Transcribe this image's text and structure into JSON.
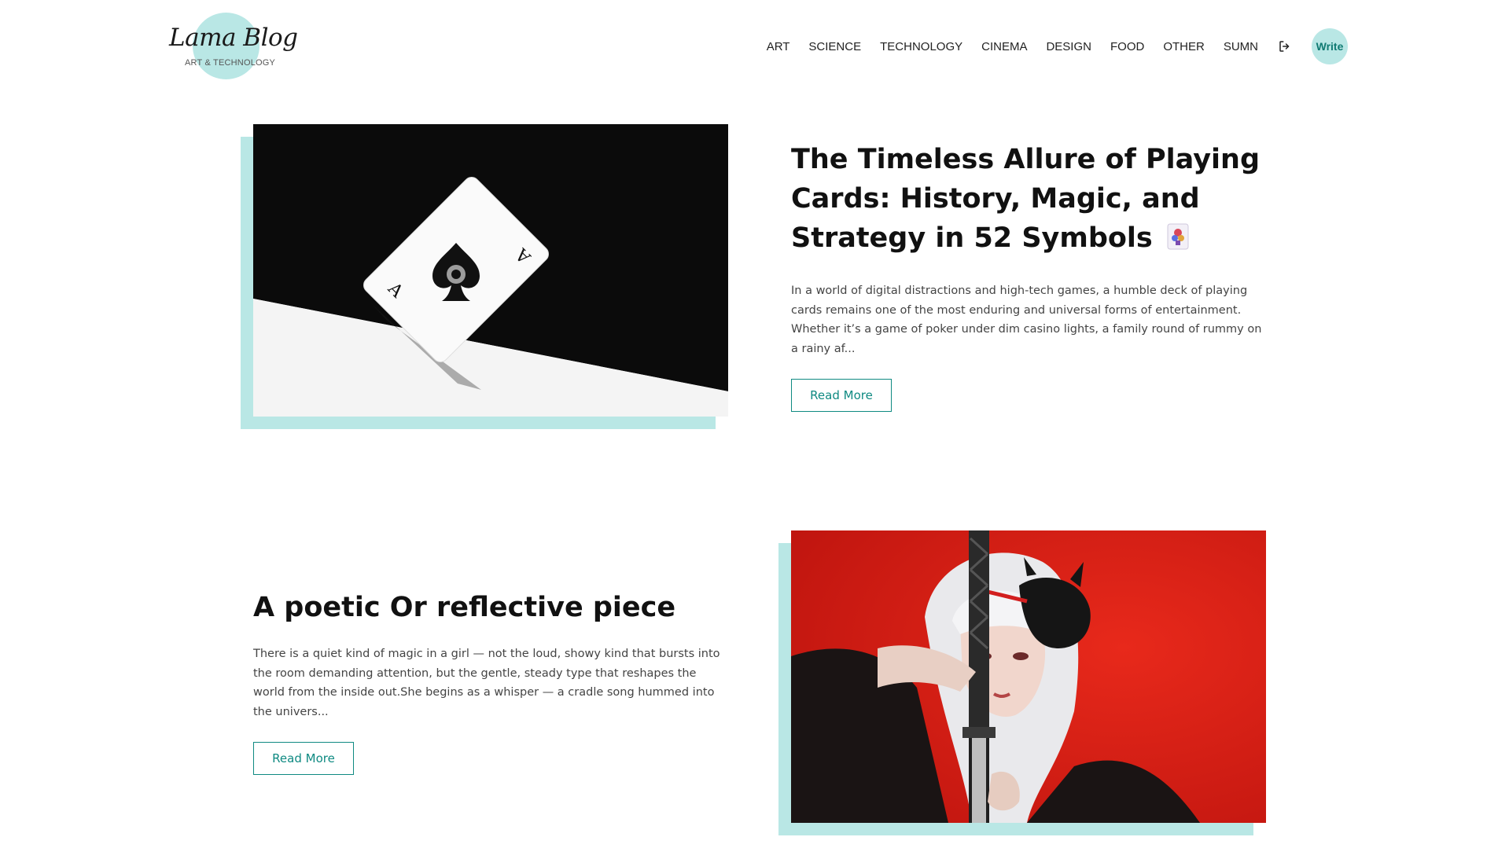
{
  "logo": {
    "title": "Lama Blog",
    "subtitle": "ART & TECHNOLOGY"
  },
  "nav": {
    "links": [
      "ART",
      "SCIENCE",
      "TECHNOLOGY",
      "CINEMA",
      "DESIGN",
      "FOOD",
      "OTHER",
      "SUMN"
    ],
    "write_label": "Write",
    "logout_icon": "logout-icon"
  },
  "posts": [
    {
      "title": "The Timeless Allure of Playing Cards: History, Magic, and Strategy in 52 Symbols",
      "title_emoji": "playing-card-icon",
      "desc": "In a world of digital distractions and high-tech games, a humble deck of playing cards remains one of the most enduring and universal forms of entertainment. Whether it’s a game of poker under dim casino lights, a family round of rummy on a rainy af...",
      "button": "Read More",
      "image": "ace-of-spades-photo"
    },
    {
      "title": "A poetic Or reflective piece",
      "desc": "There is a quiet kind of magic in a girl — not the loud, showy kind that bursts into the room demanding attention, but the gentle, steady type that reshapes the world from the inside out.She begins as a whisper — a cradle song hummed into the univers...",
      "button": "Read More",
      "image": "anime-girl-katana-illustration"
    }
  ],
  "colors": {
    "accent": "#b9e7e5",
    "button": "#0f8a82"
  }
}
